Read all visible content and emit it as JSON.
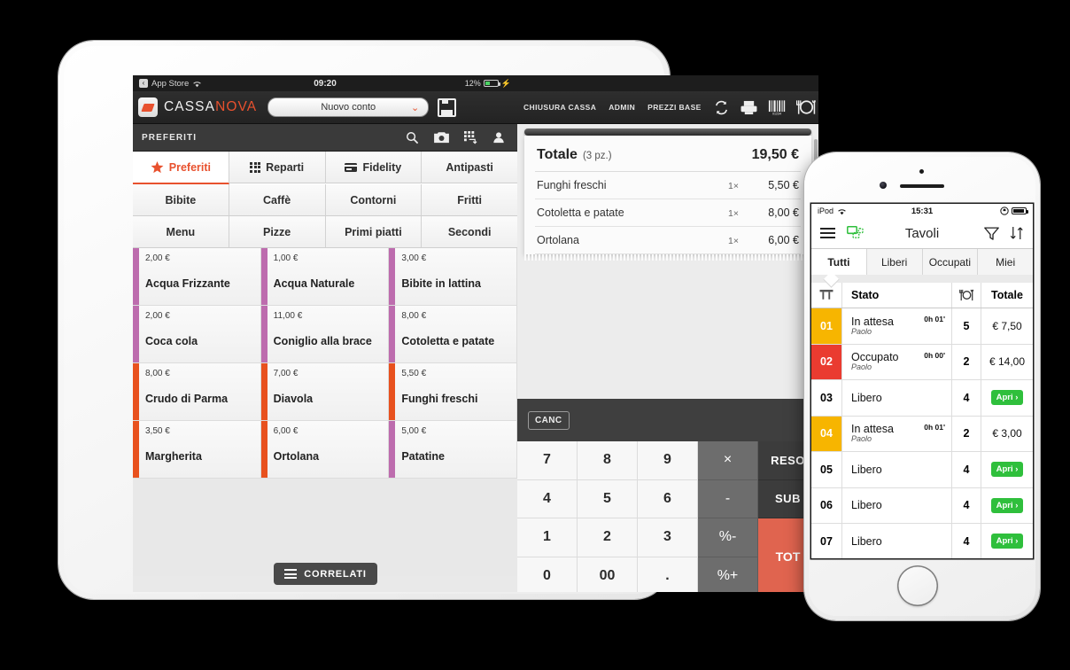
{
  "ipad": {
    "status_bar": {
      "back_label": "App Store",
      "wifi_icon": "wifi-icon",
      "time": "09:20",
      "battery_pct": "12%"
    },
    "topbar": {
      "brand_first": "CASSA",
      "brand_second": "NOVA",
      "account_select": "Nuovo conto",
      "save_icon": "save-icon",
      "buttons": [
        "CHIUSURA CASSA",
        "ADMIN",
        "PREZZI BASE"
      ],
      "icons": [
        "sync-icon",
        "printer-icon",
        "barcode-icon",
        "plate-cutlery-icon"
      ]
    },
    "section_bar": {
      "title": "PREFERITI",
      "icons": [
        "search-icon",
        "camera-icon",
        "qr-scan-icon",
        "user-icon"
      ]
    },
    "categories": [
      [
        {
          "label": "Preferiti",
          "icon": "star-icon",
          "active": true
        },
        {
          "label": "Reparti",
          "icon": "grid-icon",
          "active": false
        },
        {
          "label": "Fidelity",
          "icon": "card-icon",
          "active": false
        },
        {
          "label": "Antipasti",
          "icon": "",
          "active": false
        }
      ],
      [
        {
          "label": "Bibite",
          "icon": "",
          "active": false
        },
        {
          "label": "Caffè",
          "icon": "",
          "active": false
        },
        {
          "label": "Contorni",
          "icon": "",
          "active": false
        },
        {
          "label": "Fritti",
          "icon": "",
          "active": false
        }
      ],
      [
        {
          "label": "Menu",
          "icon": "",
          "active": false
        },
        {
          "label": "Pizze",
          "icon": "",
          "active": false
        },
        {
          "label": "Primi piatti",
          "icon": "",
          "active": false
        },
        {
          "label": "Secondi",
          "icon": "",
          "active": false
        }
      ]
    ],
    "products": [
      {
        "price": "2,00 €",
        "name": "Acqua Frizzante",
        "color": "#bd6cae"
      },
      {
        "price": "1,00 €",
        "name": "Acqua Naturale",
        "color": "#bd6cae"
      },
      {
        "price": "3,00 €",
        "name": "Bibite in lattina",
        "color": "#bd6cae"
      },
      {
        "price": "2,00 €",
        "name": "Coca cola",
        "color": "#bd6cae"
      },
      {
        "price": "11,00 €",
        "name": "Coniglio alla brace",
        "color": "#bd6cae"
      },
      {
        "price": "8,00 €",
        "name": "Cotoletta e patate",
        "color": "#bd6cae"
      },
      {
        "price": "8,00 €",
        "name": "Crudo di Parma",
        "color": "#e8511e"
      },
      {
        "price": "7,00 €",
        "name": "Diavola",
        "color": "#e8511e"
      },
      {
        "price": "5,50 €",
        "name": "Funghi freschi",
        "color": "#e8511e"
      },
      {
        "price": "3,50 €",
        "name": "Margherita",
        "color": "#e8511e"
      },
      {
        "price": "6,00 €",
        "name": "Ortolana",
        "color": "#e8511e"
      },
      {
        "price": "5,00 €",
        "name": "Patatine",
        "color": "#bd6cae"
      }
    ],
    "correlati_label": "CORRELATI",
    "receipt": {
      "total_label": "Totale",
      "pieces": "(3 pz.)",
      "total_amount": "19,50 €",
      "lines": [
        {
          "name": "Funghi freschi",
          "qty": "1×",
          "price": "5,50 €"
        },
        {
          "name": "Cotoletta e patate",
          "qty": "1×",
          "price": "8,00 €"
        },
        {
          "name": "Ortolana",
          "qty": "1×",
          "price": "6,00 €"
        }
      ]
    },
    "keypad": {
      "canc_label": "CANC",
      "keys": [
        "7",
        "8",
        "9",
        "4",
        "5",
        "6",
        "1",
        "2",
        "3",
        "0",
        "00",
        "."
      ],
      "ops": [
        "×",
        "-",
        "%-",
        "%+"
      ],
      "reso_label": "RESO",
      "sub_label": "SUB",
      "tot_label": "TOT"
    }
  },
  "iphone": {
    "status_bar": {
      "carrier": "iPod",
      "wifi_icon": "wifi-icon",
      "time": "15:31",
      "lock_icon": "rotation-lock-icon"
    },
    "nav": {
      "menu_icon": "hamburger-menu-icon",
      "tables_icon": "tables-group-icon",
      "title": "Tavoli",
      "filter_icon": "filter-icon",
      "sort_icon": "sort-icon"
    },
    "tabs": [
      {
        "label": "Tutti",
        "active": true
      },
      {
        "label": "Liberi",
        "active": false
      },
      {
        "label": "Occupati",
        "active": false
      },
      {
        "label": "Miei",
        "active": false
      }
    ],
    "table_headers": {
      "number_icon": "table-icon",
      "status": "Stato",
      "covers_icon": "cutlery-plate-icon",
      "total": "Totale"
    },
    "rows": [
      {
        "num": "01",
        "num_color": "amber",
        "status": "In attesa",
        "waiter": "Paolo",
        "time": "0h 01'",
        "covers": "5",
        "total": "€ 7,50",
        "action": ""
      },
      {
        "num": "02",
        "num_color": "red",
        "status": "Occupato",
        "waiter": "Paolo",
        "time": "0h 00'",
        "covers": "2",
        "total": "€ 14,00",
        "action": ""
      },
      {
        "num": "03",
        "num_color": "plain",
        "status": "Libero",
        "waiter": "",
        "time": "",
        "covers": "4",
        "total": "",
        "action": "Apri ›"
      },
      {
        "num": "04",
        "num_color": "amber",
        "status": "In attesa",
        "waiter": "Paolo",
        "time": "0h 01'",
        "covers": "2",
        "total": "€ 3,00",
        "action": ""
      },
      {
        "num": "05",
        "num_color": "plain",
        "status": "Libero",
        "waiter": "",
        "time": "",
        "covers": "4",
        "total": "",
        "action": "Apri ›"
      },
      {
        "num": "06",
        "num_color": "plain",
        "status": "Libero",
        "waiter": "",
        "time": "",
        "covers": "4",
        "total": "",
        "action": "Apri ›"
      },
      {
        "num": "07",
        "num_color": "plain",
        "status": "Libero",
        "waiter": "",
        "time": "",
        "covers": "4",
        "total": "",
        "action": "Apri ›"
      }
    ]
  },
  "colors": {
    "accent_orange": "#e8512e",
    "accent_purple": "#bd6cae",
    "amber": "#f7b500",
    "red": "#ea3b30",
    "green": "#2fbf3c",
    "total_button": "#e0644f"
  }
}
